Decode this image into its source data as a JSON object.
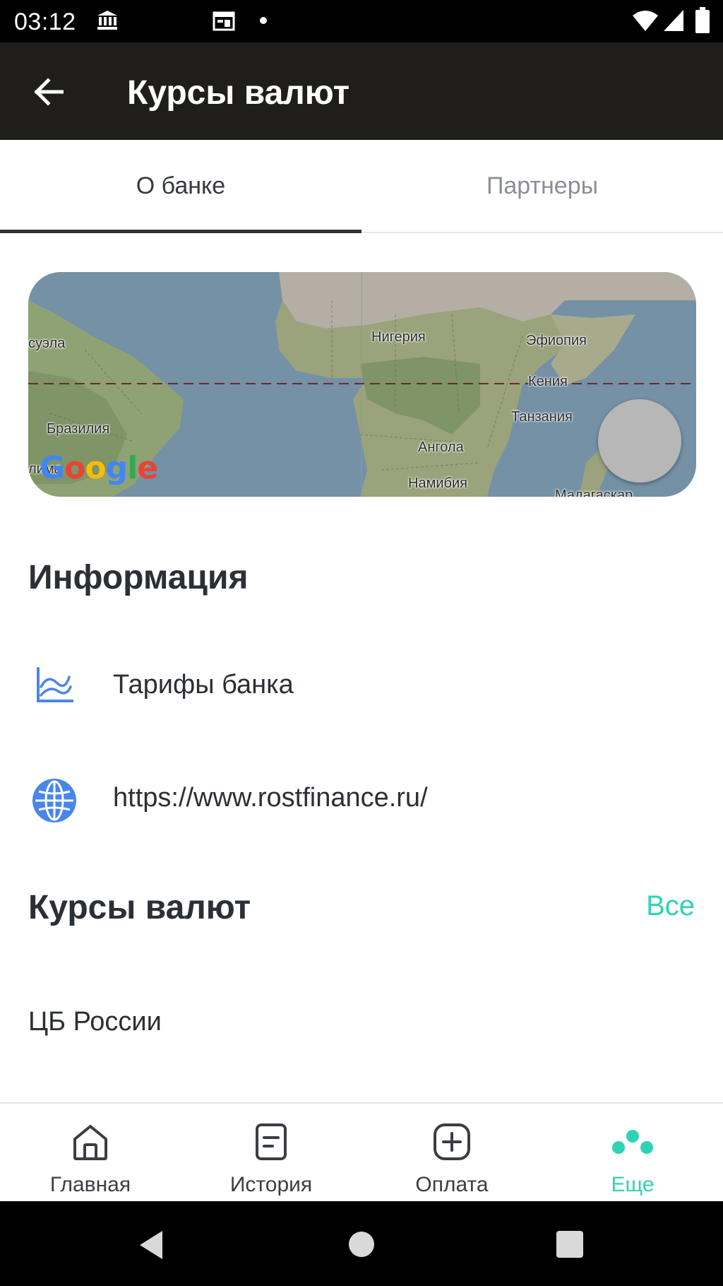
{
  "status_bar": {
    "time": "03:12",
    "icons": [
      "bank-icon",
      "calendar-icon",
      "dot-icon",
      "wifi-icon",
      "signal-icon",
      "battery-icon"
    ]
  },
  "app_bar": {
    "title": "Курсы валют",
    "back_icon": "arrow-left-icon"
  },
  "tabs": [
    {
      "label": "О банке",
      "active": true
    },
    {
      "label": "Партнеры",
      "active": false
    }
  ],
  "map": {
    "labels": [
      "суэла",
      "Нигерия",
      "Эфиопия",
      "Кения",
      "Бразилия",
      "Танзания",
      "Ангола",
      "Намибия",
      "Мадагаскар",
      "лима"
    ],
    "logo": "Google",
    "water_color": "#7491a6",
    "land_color": "#9aa37b"
  },
  "info_section": {
    "heading": "Информация",
    "items": [
      {
        "label": "Тарифы банка",
        "icon": "chart-line-icon"
      },
      {
        "label": "https://www.rostfinance.ru/",
        "icon": "globe-icon"
      }
    ]
  },
  "rates_section": {
    "heading": "Курсы валют",
    "see_all": "Все",
    "source": "ЦБ России"
  },
  "bottom_nav": [
    {
      "label": "Главная",
      "icon": "home-icon",
      "active": false
    },
    {
      "label": "История",
      "icon": "history-icon",
      "active": false
    },
    {
      "label": "Оплата",
      "icon": "add-square-icon",
      "active": false
    },
    {
      "label": "Еще",
      "icon": "more-dots-icon",
      "active": true
    }
  ],
  "colors": {
    "accent": "#2fd3b4",
    "app_bar": "#1f1e1b",
    "icon_blue": "#4a86e8"
  }
}
